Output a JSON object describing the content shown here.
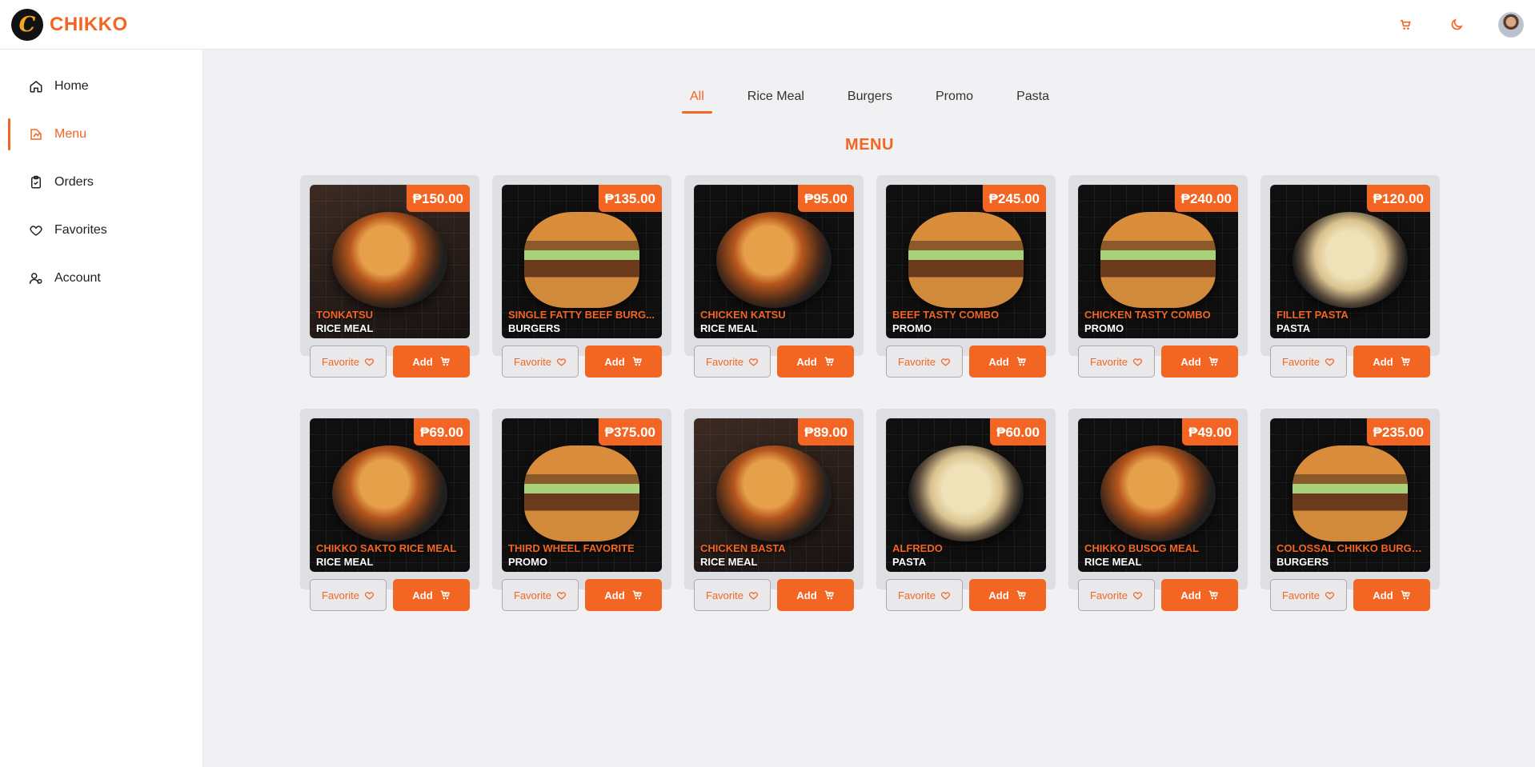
{
  "brand": {
    "name": "CHIKKO",
    "logo_letter": "C"
  },
  "header": {
    "cart_icon": "cart-icon",
    "theme_icon": "moon-icon"
  },
  "sidebar": {
    "items": [
      {
        "label": "Home",
        "icon": "home-icon",
        "active": false
      },
      {
        "label": "Menu",
        "icon": "menu-icon",
        "active": true
      },
      {
        "label": "Orders",
        "icon": "clipboard-icon",
        "active": false
      },
      {
        "label": "Favorites",
        "icon": "heart-icon",
        "active": false
      },
      {
        "label": "Account",
        "icon": "user-icon",
        "active": false
      }
    ]
  },
  "tabs": [
    {
      "label": "All",
      "active": true
    },
    {
      "label": "Rice Meal",
      "active": false
    },
    {
      "label": "Burgers",
      "active": false
    },
    {
      "label": "Promo",
      "active": false
    },
    {
      "label": "Pasta",
      "active": false
    }
  ],
  "section_title": "MENU",
  "buttons": {
    "favorite": "Favorite",
    "add": "Add"
  },
  "accent_color": "#f26522",
  "menu_items": [
    {
      "name": "TONKATSU",
      "category": "RICE MEAL",
      "price": "₱150.00",
      "style": "photo"
    },
    {
      "name": "SINGLE FATTY BEEF BURG...",
      "category": "BURGERS",
      "price": "₱135.00",
      "style": "burger"
    },
    {
      "name": "CHICKEN KATSU",
      "category": "RICE MEAL",
      "price": "₱95.00",
      "style": "plate"
    },
    {
      "name": "BEEF TASTY COMBO",
      "category": "PROMO",
      "price": "₱245.00",
      "style": "burger"
    },
    {
      "name": "CHICKEN TASTY COMBO",
      "category": "PROMO",
      "price": "₱240.00",
      "style": "burger"
    },
    {
      "name": "FILLET PASTA",
      "category": "PASTA",
      "price": "₱120.00",
      "style": "pasta"
    },
    {
      "name": "CHIKKO SAKTO RICE MEAL",
      "category": "RICE MEAL",
      "price": "₱69.00",
      "style": "plate"
    },
    {
      "name": "THIRD WHEEL FAVORITE",
      "category": "PROMO",
      "price": "₱375.00",
      "style": "burger"
    },
    {
      "name": "CHICKEN BASTA",
      "category": "RICE MEAL",
      "price": "₱89.00",
      "style": "photo"
    },
    {
      "name": "ALFREDO",
      "category": "PASTA",
      "price": "₱60.00",
      "style": "pasta"
    },
    {
      "name": "CHIKKO BUSOG MEAL",
      "category": "RICE MEAL",
      "price": "₱49.00",
      "style": "plate"
    },
    {
      "name": "COLOSSAL CHIKKO BURGER",
      "category": "BURGERS",
      "price": "₱235.00",
      "style": "burger"
    }
  ]
}
